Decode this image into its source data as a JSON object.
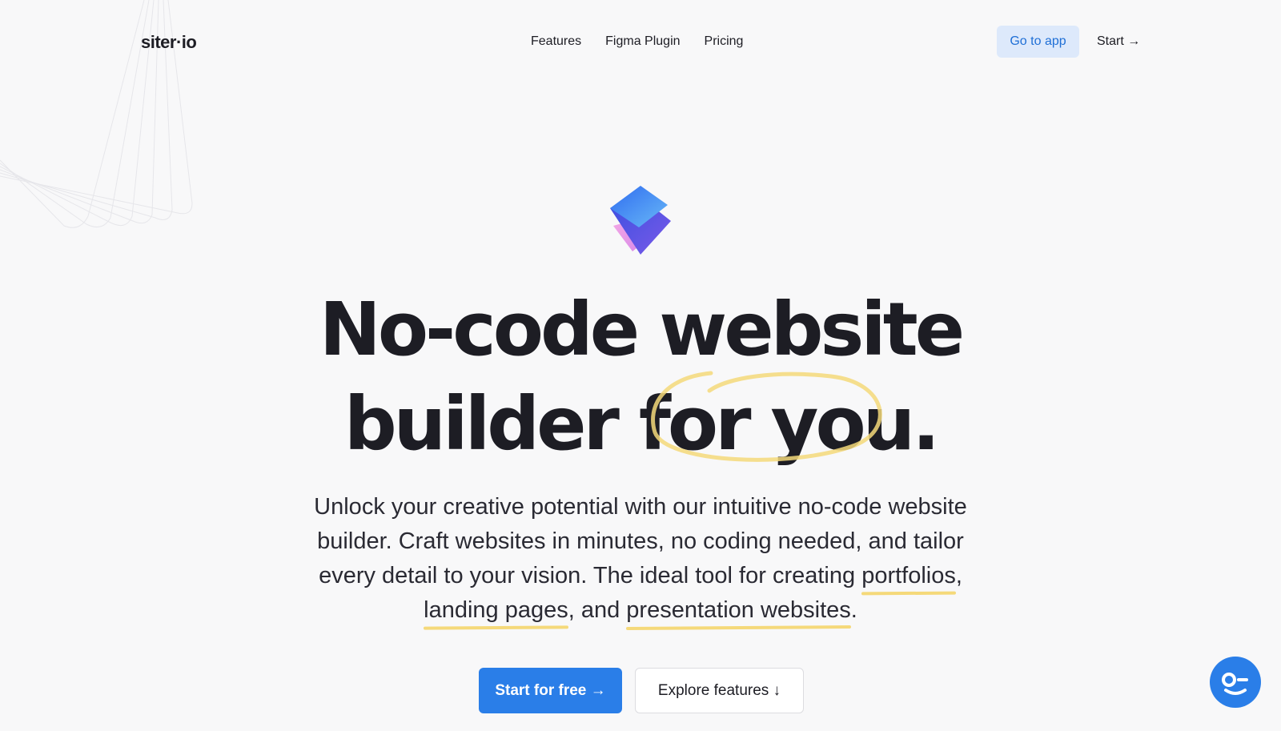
{
  "header": {
    "logo": "siter·io",
    "nav": [
      "Features",
      "Figma Plugin",
      "Pricing"
    ],
    "go_to_app": "Go to app",
    "start": "Start →"
  },
  "hero": {
    "headline_line1": "No-code website",
    "headline_line2_pre": "builder ",
    "headline_line2_highlight": "for you",
    "headline_line2_post": ".",
    "subtitle_part1": "Unlock your creative potential with our intuitive no-code website builder. Craft websites in minutes, no coding needed, and tailor every detail to your vision. The ideal tool for creating ",
    "subtitle_link1": "portfolios",
    "subtitle_sep1": ", ",
    "subtitle_link2": "landing pages",
    "subtitle_sep2": ", and ",
    "subtitle_link3": "presentation websites",
    "subtitle_end": ".",
    "cta_primary": "Start for free →",
    "cta_secondary": "Explore features ↓"
  },
  "colors": {
    "accent": "#2a7ee8",
    "highlight": "#f5d97a",
    "background": "#f8f8f9"
  },
  "icons": [
    "logo-mark-icon",
    "chat-support-icon"
  ]
}
